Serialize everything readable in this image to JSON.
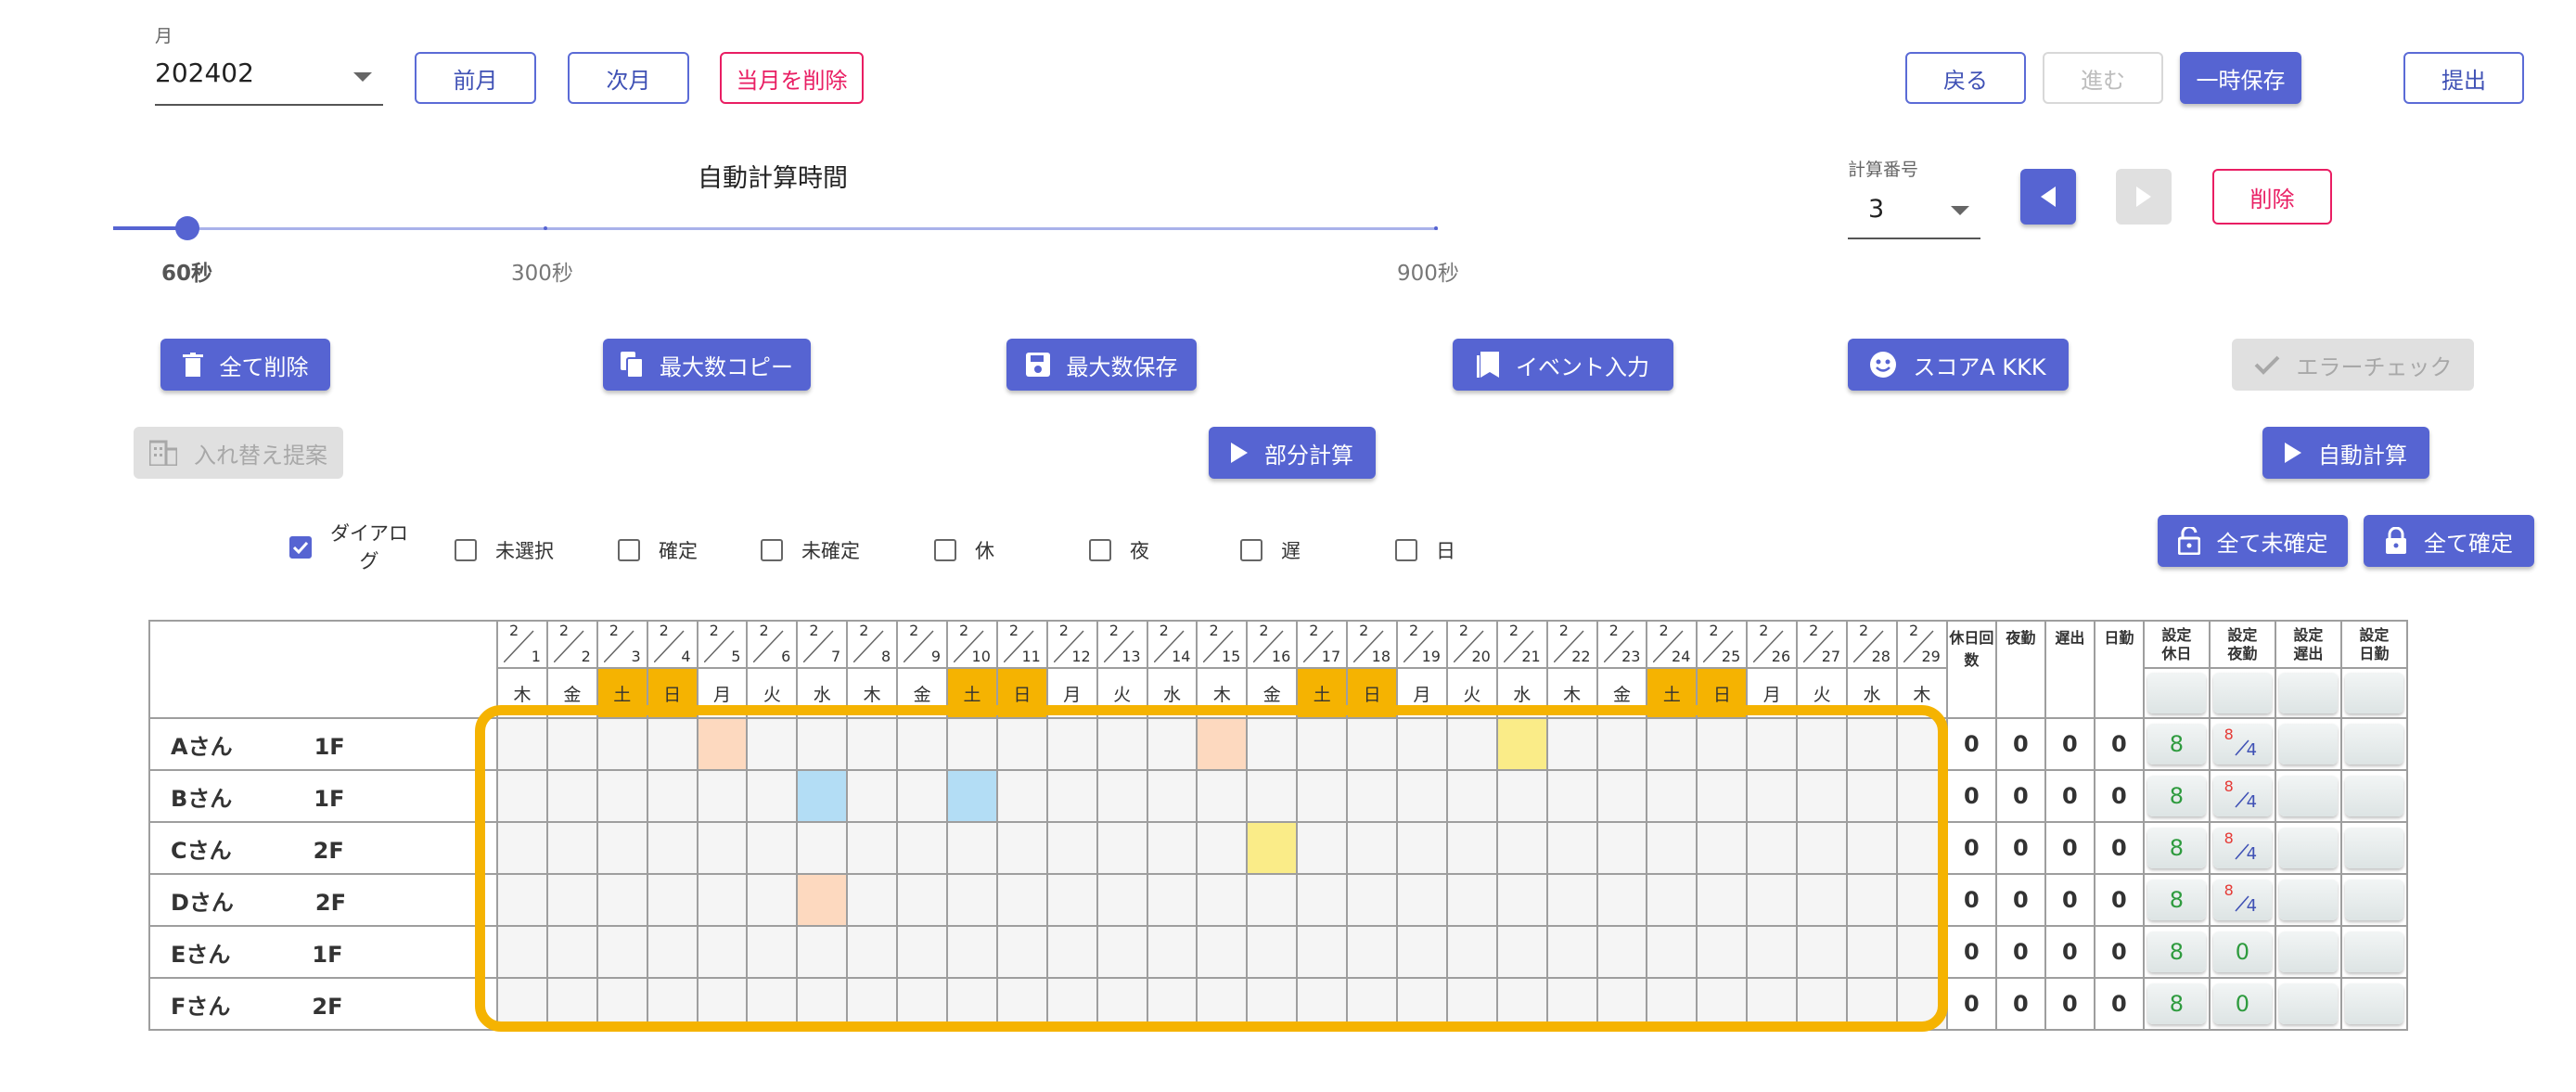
{
  "month": {
    "label": "月",
    "value": "202402"
  },
  "nav": {
    "prev": "前月",
    "next": "次月",
    "delete_month": "当月を削除"
  },
  "top_right": {
    "back": "戻る",
    "forward": "進む",
    "temp_save": "一時保存",
    "submit": "提出"
  },
  "slider": {
    "title": "自動計算時間",
    "ticks": [
      "60秒",
      "300秒",
      "900秒"
    ],
    "value": "60秒"
  },
  "calc": {
    "label": "計算番号",
    "value": "3",
    "delete": "削除"
  },
  "actions": {
    "delete_all": "全て削除",
    "copy_max": "最大数コピー",
    "save_max": "最大数保存",
    "event_input": "イベント入力",
    "score": "スコアA KKK",
    "error_check": "エラーチェック",
    "swap_suggest": "入れ替え提案",
    "partial_calc": "部分計算",
    "auto_calc": "自動計算",
    "all_unconfirm": "全て未確定",
    "all_confirm": "全て確定"
  },
  "filters": [
    {
      "label": "ダイアロ\nグ",
      "checked": true
    },
    {
      "label": "未選択",
      "checked": false
    },
    {
      "label": "確定",
      "checked": false
    },
    {
      "label": "未確定",
      "checked": false
    },
    {
      "label": "休",
      "checked": false
    },
    {
      "label": "夜",
      "checked": false
    },
    {
      "label": "遅",
      "checked": false
    },
    {
      "label": "日",
      "checked": false
    }
  ],
  "calendar": {
    "month": "2",
    "days": [
      "1",
      "2",
      "3",
      "4",
      "5",
      "6",
      "7",
      "8",
      "9",
      "10",
      "11",
      "12",
      "13",
      "14",
      "15",
      "16",
      "17",
      "18",
      "19",
      "20",
      "21",
      "22",
      "23",
      "24",
      "25",
      "26",
      "27",
      "28",
      "29"
    ],
    "weekdays": [
      "木",
      "金",
      "土",
      "日",
      "月",
      "火",
      "水",
      "木",
      "金",
      "土",
      "日",
      "月",
      "火",
      "水",
      "木",
      "金",
      "土",
      "日",
      "月",
      "火",
      "水",
      "木",
      "金",
      "土",
      "日",
      "月",
      "火",
      "水",
      "木"
    ],
    "summary_headers": [
      "休日回数",
      "夜勤",
      "遅出",
      "日勤"
    ],
    "setting_headers": [
      "設定休日",
      "設定夜勤",
      "設定遅出",
      "設定日勤"
    ],
    "rows": [
      {
        "name": "Aさん",
        "floor": "1F",
        "counts": [
          "0",
          "0",
          "0",
          "0"
        ],
        "set_holiday": "8",
        "set_night": {
          "top": "8",
          "bottom": "4"
        }
      },
      {
        "name": "Bさん",
        "floor": "1F",
        "counts": [
          "0",
          "0",
          "0",
          "0"
        ],
        "set_holiday": "8",
        "set_night": {
          "top": "8",
          "bottom": "4"
        }
      },
      {
        "name": "Cさん",
        "floor": "2F",
        "counts": [
          "0",
          "0",
          "0",
          "0"
        ],
        "set_holiday": "8",
        "set_night": {
          "top": "8",
          "bottom": "4"
        }
      },
      {
        "name": "Dさん",
        "floor": "2F",
        "counts": [
          "0",
          "0",
          "0",
          "0"
        ],
        "set_holiday": "8",
        "set_night": {
          "top": "8",
          "bottom": "4"
        }
      },
      {
        "name": "Eさん",
        "floor": "1F",
        "counts": [
          "0",
          "0",
          "0",
          "0"
        ],
        "set_holiday": "8",
        "set_night": {
          "top": "0",
          "bottom": ""
        }
      },
      {
        "name": "Fさん",
        "floor": "2F",
        "counts": [
          "0",
          "0",
          "0",
          "0"
        ],
        "set_holiday": "8",
        "set_night": {
          "top": "0",
          "bottom": ""
        }
      }
    ],
    "highlights": [
      {
        "row": 0,
        "day": 5,
        "color": "orange"
      },
      {
        "row": 0,
        "day": 15,
        "color": "orange"
      },
      {
        "row": 0,
        "day": 21,
        "color": "yellow"
      },
      {
        "row": 1,
        "day": 7,
        "color": "blue"
      },
      {
        "row": 1,
        "day": 10,
        "color": "blue"
      },
      {
        "row": 2,
        "day": 16,
        "color": "yellow"
      },
      {
        "row": 3,
        "day": 7,
        "color": "orange"
      }
    ]
  },
  "colors": {
    "accent": "#5664d2",
    "weekend": "#f5b301",
    "highlight_border": "#f5b301",
    "delete": "#e91e63"
  }
}
